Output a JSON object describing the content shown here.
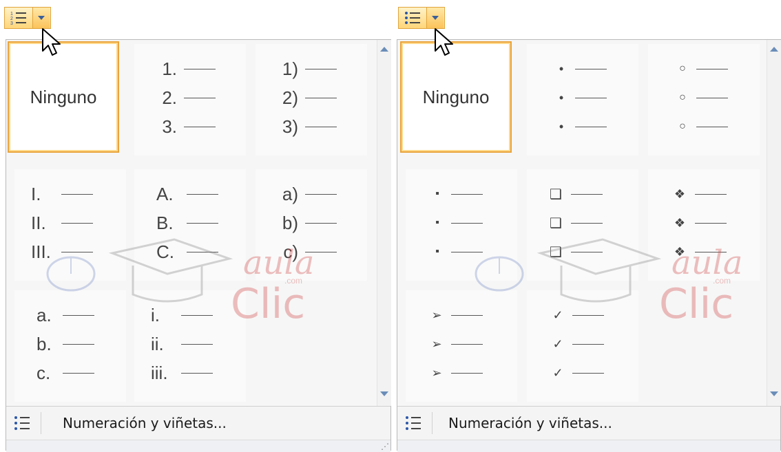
{
  "left_menu": {
    "none_label": "Ninguno",
    "footer_label": "Numeración y viñetas...",
    "styles": [
      {
        "markers": [
          "1.",
          "2.",
          "3."
        ]
      },
      {
        "markers": [
          "1)",
          "2)",
          "3)"
        ]
      },
      {
        "markers": [
          "I.",
          "II.",
          "III."
        ]
      },
      {
        "markers": [
          "A.",
          "B.",
          "C."
        ]
      },
      {
        "markers": [
          "a)",
          "b)",
          "c)"
        ]
      },
      {
        "markers": [
          "a.",
          "b.",
          "c."
        ]
      },
      {
        "markers": [
          "i.",
          "ii.",
          "iii."
        ]
      }
    ]
  },
  "right_menu": {
    "none_label": "Ninguno",
    "footer_label": "Numeración y viñetas...",
    "styles": [
      {
        "markers": [
          "•",
          "•",
          "•"
        ]
      },
      {
        "markers": [
          "○",
          "○",
          "○"
        ]
      },
      {
        "markers": [
          "▪",
          "▪",
          "▪"
        ]
      },
      {
        "markers": [
          "❑",
          "❑",
          "❑"
        ]
      },
      {
        "markers": [
          "❖",
          "❖",
          "❖"
        ]
      },
      {
        "markers": [
          "➢",
          "➢",
          "➢"
        ]
      },
      {
        "markers": [
          "✓",
          "✓",
          "✓"
        ]
      }
    ]
  },
  "watermark": {
    "top": "aula",
    "com": ".com",
    "bottom": "Clic"
  },
  "icons": {
    "numbering": "numbered-list-icon",
    "bullets": "bulleted-list-icon",
    "dropdown": "dropdown-arrow-icon",
    "cursor": "mouse-pointer-icon"
  },
  "colors": {
    "selection_border": "#e9a43b",
    "button_fill": "#ffd67a",
    "scroll_arrow": "#6a8db8",
    "watermark": "#d24a4a"
  }
}
